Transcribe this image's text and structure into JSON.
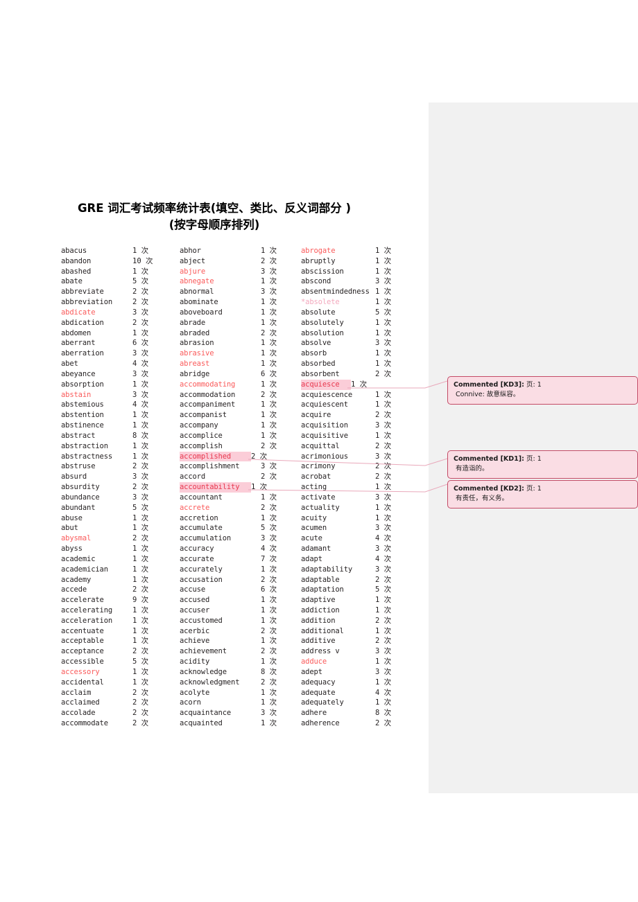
{
  "document": {
    "title_line_1": "GRE 词汇考试频率统计表(填空、类比、反义词部分 )",
    "title_line_2": "(按字母顺序排列)"
  },
  "colors": {
    "margin_panel": "#f1f1f1",
    "red_word": "#fa5a5a",
    "faded_word": "#f3a8bd",
    "highlight_bg": "#fbcdd8",
    "highlight_text": "#e8384f",
    "comment_bg": "#fadde4",
    "comment_border": "#c34a66"
  },
  "columns": [
    {
      "name": "column-1",
      "entries": [
        {
          "term": "abacus",
          "count": "1 次",
          "style": "normal"
        },
        {
          "term": "abandon",
          "count": "10 次",
          "style": "normal"
        },
        {
          "term": "abashed",
          "count": "1 次",
          "style": "normal"
        },
        {
          "term": "abate",
          "count": "5 次",
          "style": "normal"
        },
        {
          "term": "abbreviate",
          "count": "2 次",
          "style": "normal"
        },
        {
          "term": "abbreviation",
          "count": "2 次",
          "style": "normal"
        },
        {
          "term": "abdicate",
          "count": "3 次",
          "style": "red"
        },
        {
          "term": "abdication",
          "count": "2 次",
          "style": "normal"
        },
        {
          "term": "abdomen",
          "count": "1 次",
          "style": "normal"
        },
        {
          "term": "aberrant",
          "count": "6 次",
          "style": "normal"
        },
        {
          "term": "aberration",
          "count": "3 次",
          "style": "normal"
        },
        {
          "term": "abet",
          "count": "4 次",
          "style": "normal"
        },
        {
          "term": "abeyance",
          "count": "3 次",
          "style": "normal"
        },
        {
          "term": "absorption",
          "count": "1 次",
          "style": "normal"
        },
        {
          "term": "abstain",
          "count": "3 次",
          "style": "red"
        },
        {
          "term": "abstemious",
          "count": "4 次",
          "style": "normal"
        },
        {
          "term": "abstention",
          "count": "1 次",
          "style": "normal"
        },
        {
          "term": "abstinence",
          "count": "1 次",
          "style": "normal"
        },
        {
          "term": "abstract",
          "count": "8 次",
          "style": "normal"
        },
        {
          "term": "abstraction",
          "count": "1 次",
          "style": "normal"
        },
        {
          "term": "abstractness",
          "count": "1 次",
          "style": "normal"
        },
        {
          "term": "abstruse",
          "count": "2 次",
          "style": "normal"
        },
        {
          "term": "absurd",
          "count": "3 次",
          "style": "normal"
        },
        {
          "term": "absurdity",
          "count": "2 次",
          "style": "normal"
        },
        {
          "term": "abundance",
          "count": "3 次",
          "style": "normal"
        },
        {
          "term": "abundant",
          "count": "5 次",
          "style": "normal"
        },
        {
          "term": "abuse",
          "count": "1 次",
          "style": "normal"
        },
        {
          "term": "abut",
          "count": "1 次",
          "style": "normal"
        },
        {
          "term": "abysmal",
          "count": "2 次",
          "style": "red"
        },
        {
          "term": "abyss",
          "count": "1 次",
          "style": "normal"
        },
        {
          "term": "academic",
          "count": "1 次",
          "style": "normal"
        },
        {
          "term": "academician",
          "count": "1 次",
          "style": "normal"
        },
        {
          "term": "academy",
          "count": "1 次",
          "style": "normal"
        },
        {
          "term": "accede",
          "count": "2 次",
          "style": "normal"
        },
        {
          "term": "accelerate",
          "count": "9 次",
          "style": "normal"
        },
        {
          "term": "accelerating",
          "count": "1 次",
          "style": "normal"
        },
        {
          "term": "acceleration",
          "count": "1 次",
          "style": "normal"
        },
        {
          "term": "accentuate",
          "count": "1 次",
          "style": "normal"
        },
        {
          "term": "acceptable",
          "count": "1 次",
          "style": "normal"
        },
        {
          "term": "acceptance",
          "count": "2 次",
          "style": "normal"
        },
        {
          "term": "accessible",
          "count": "5 次",
          "style": "normal"
        },
        {
          "term": "accessory",
          "count": "1 次",
          "style": "red"
        },
        {
          "term": "accidental",
          "count": "1 次",
          "style": "normal"
        },
        {
          "term": "acclaim",
          "count": "2 次",
          "style": "normal"
        },
        {
          "term": "acclaimed",
          "count": "2 次",
          "style": "normal"
        },
        {
          "term": "accolade",
          "count": "2 次",
          "style": "normal"
        },
        {
          "term": "accommodate",
          "count": "2 次",
          "style": "normal"
        }
      ]
    },
    {
      "name": "column-2",
      "entries": [
        {
          "term": "abhor",
          "count": "1 次",
          "style": "normal"
        },
        {
          "term": "abject",
          "count": "2 次",
          "style": "normal"
        },
        {
          "term": "abjure",
          "count": "3 次",
          "style": "red"
        },
        {
          "term": "abnegate",
          "count": "1 次",
          "style": "red"
        },
        {
          "term": "abnormal",
          "count": "3 次",
          "style": "normal"
        },
        {
          "term": "abominate",
          "count": "1 次",
          "style": "normal"
        },
        {
          "term": "aboveboard",
          "count": "1 次",
          "style": "normal"
        },
        {
          "term": "abrade",
          "count": "1 次",
          "style": "normal"
        },
        {
          "term": "abraded",
          "count": "2 次",
          "style": "normal"
        },
        {
          "term": "abrasion",
          "count": "1 次",
          "style": "normal"
        },
        {
          "term": "abrasive",
          "count": "1 次",
          "style": "red"
        },
        {
          "term": "abreast",
          "count": "1 次",
          "style": "red"
        },
        {
          "term": "abridge",
          "count": "6 次",
          "style": "normal"
        },
        {
          "term": "accommodating",
          "count": "1 次",
          "style": "red"
        },
        {
          "term": "accommodation",
          "count": "2 次",
          "style": "normal"
        },
        {
          "term": "accompaniment",
          "count": "1 次",
          "style": "normal"
        },
        {
          "term": "accompanist",
          "count": "1 次",
          "style": "normal"
        },
        {
          "term": "accompany",
          "count": "1 次",
          "style": "normal"
        },
        {
          "term": "accomplice",
          "count": "1 次",
          "style": "normal"
        },
        {
          "term": "accomplish",
          "count": "2 次",
          "style": "normal"
        },
        {
          "term": "accomplished",
          "count": "2 次",
          "style": "anchor"
        },
        {
          "term": "accomplishment",
          "count": "3 次",
          "style": "normal"
        },
        {
          "term": "accord",
          "count": "2 次",
          "style": "normal"
        },
        {
          "term": "accountability",
          "count": "1 次",
          "style": "anchor"
        },
        {
          "term": "accountant",
          "count": "1 次",
          "style": "normal"
        },
        {
          "term": "accrete",
          "count": "2 次",
          "style": "red"
        },
        {
          "term": "accretion",
          "count": "1 次",
          "style": "normal"
        },
        {
          "term": "accumulate",
          "count": "5 次",
          "style": "normal"
        },
        {
          "term": "accumulation",
          "count": "3 次",
          "style": "normal"
        },
        {
          "term": "accuracy",
          "count": "4 次",
          "style": "normal"
        },
        {
          "term": "accurate",
          "count": "7 次",
          "style": "normal"
        },
        {
          "term": "accurately",
          "count": "1 次",
          "style": "normal"
        },
        {
          "term": "accusation",
          "count": "2 次",
          "style": "normal"
        },
        {
          "term": "accuse",
          "count": "6 次",
          "style": "normal"
        },
        {
          "term": "accused",
          "count": "1 次",
          "style": "normal"
        },
        {
          "term": "accuser",
          "count": "1 次",
          "style": "normal"
        },
        {
          "term": "accustomed",
          "count": "1 次",
          "style": "normal"
        },
        {
          "term": "acerbic",
          "count": "2 次",
          "style": "normal"
        },
        {
          "term": "achieve",
          "count": "1 次",
          "style": "normal"
        },
        {
          "term": "achievement",
          "count": "2 次",
          "style": "normal"
        },
        {
          "term": "acidity",
          "count": "1 次",
          "style": "normal"
        },
        {
          "term": "acknowledge",
          "count": "8 次",
          "style": "normal"
        },
        {
          "term": "acknowledgment",
          "count": "2 次",
          "style": "normal"
        },
        {
          "term": "acolyte",
          "count": "1 次",
          "style": "normal"
        },
        {
          "term": "acorn",
          "count": "1 次",
          "style": "normal"
        },
        {
          "term": "acquaintance",
          "count": "3 次",
          "style": "normal"
        },
        {
          "term": "acquainted",
          "count": "1 次",
          "style": "normal"
        }
      ]
    },
    {
      "name": "column-3",
      "entries": [
        {
          "term": "abrogate",
          "count": "1 次",
          "style": "red"
        },
        {
          "term": "abruptly",
          "count": "1 次",
          "style": "normal"
        },
        {
          "term": "abscission",
          "count": "1 次",
          "style": "normal"
        },
        {
          "term": "abscond",
          "count": "3 次",
          "style": "normal"
        },
        {
          "term": "absentmindedness",
          "count": "1 次",
          "style": "normal"
        },
        {
          "term": "*absolete",
          "count": "1 次",
          "style": "faded"
        },
        {
          "term": "absolute",
          "count": "5 次",
          "style": "normal"
        },
        {
          "term": "absolutely",
          "count": "1 次",
          "style": "normal"
        },
        {
          "term": "absolution",
          "count": "1 次",
          "style": "normal"
        },
        {
          "term": "absolve",
          "count": "3 次",
          "style": "normal"
        },
        {
          "term": "absorb",
          "count": "1 次",
          "style": "normal"
        },
        {
          "term": "absorbed",
          "count": "1 次",
          "style": "normal"
        },
        {
          "term": "absorbent",
          "count": "2 次",
          "style": "normal"
        },
        {
          "term": "acquiesce",
          "count": "1 次",
          "style": "anchor"
        },
        {
          "term": "acquiescence",
          "count": "1 次",
          "style": "normal"
        },
        {
          "term": "acquiescent",
          "count": "1 次",
          "style": "normal"
        },
        {
          "term": "acquire",
          "count": "2 次",
          "style": "normal"
        },
        {
          "term": "acquisition",
          "count": "3 次",
          "style": "normal"
        },
        {
          "term": "acquisitive",
          "count": "1 次",
          "style": "normal"
        },
        {
          "term": "acquittal",
          "count": "2 次",
          "style": "normal"
        },
        {
          "term": "acrimonious",
          "count": "3 次",
          "style": "normal"
        },
        {
          "term": "acrimony",
          "count": "2 次",
          "style": "normal"
        },
        {
          "term": "acrobat",
          "count": "2 次",
          "style": "normal"
        },
        {
          "term": "acting",
          "count": "1 次",
          "style": "normal"
        },
        {
          "term": "activate",
          "count": "3 次",
          "style": "normal"
        },
        {
          "term": "actuality",
          "count": "1 次",
          "style": "normal"
        },
        {
          "term": "acuity",
          "count": "1 次",
          "style": "normal"
        },
        {
          "term": "acumen",
          "count": "3 次",
          "style": "normal"
        },
        {
          "term": "acute",
          "count": "4 次",
          "style": "normal"
        },
        {
          "term": "adamant",
          "count": "3 次",
          "style": "normal"
        },
        {
          "term": "adapt",
          "count": "4 次",
          "style": "normal"
        },
        {
          "term": "adaptability",
          "count": "3 次",
          "style": "normal"
        },
        {
          "term": "adaptable",
          "count": "2 次",
          "style": "normal"
        },
        {
          "term": "adaptation",
          "count": "5 次",
          "style": "normal"
        },
        {
          "term": "adaptive",
          "count": "1 次",
          "style": "normal"
        },
        {
          "term": "addiction",
          "count": "1 次",
          "style": "normal"
        },
        {
          "term": "addition",
          "count": "2 次",
          "style": "normal"
        },
        {
          "term": "additional",
          "count": "1 次",
          "style": "normal"
        },
        {
          "term": "additive",
          "count": "2 次",
          "style": "normal"
        },
        {
          "term": "address v",
          "count": "3 次",
          "style": "normal"
        },
        {
          "term": "adduce",
          "count": "1 次",
          "style": "red"
        },
        {
          "term": "adept",
          "count": "3 次",
          "style": "normal"
        },
        {
          "term": "adequacy",
          "count": "1 次",
          "style": "normal"
        },
        {
          "term": "adequate",
          "count": "4 次",
          "style": "normal"
        },
        {
          "term": "adequately",
          "count": "1 次",
          "style": "normal"
        },
        {
          "term": "adhere",
          "count": "8 次",
          "style": "normal"
        },
        {
          "term": "adherence",
          "count": "2 次",
          "style": "normal"
        }
      ]
    }
  ],
  "comments": [
    {
      "id": "KD3",
      "label": "Commented [KD3]:",
      "page": "页: 1",
      "body": "Connive: 故意纵容。"
    },
    {
      "id": "KD1",
      "label": "Commented [KD1]:",
      "page": "页: 1",
      "body": "有造诣的。"
    },
    {
      "id": "KD2",
      "label": "Commented [KD2]:",
      "page": "页: 1",
      "body": "有责任，有义务。"
    }
  ]
}
